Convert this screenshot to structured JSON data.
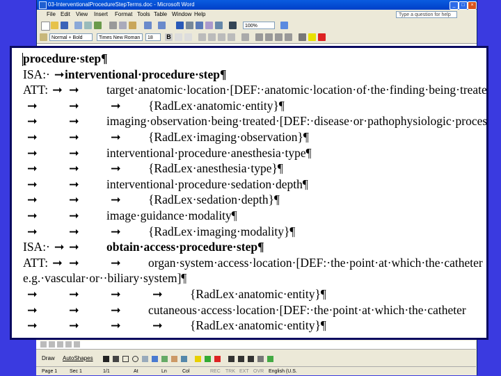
{
  "window": {
    "title": "03-InterventionalProcedureStepTerms.doc - Microsoft Word"
  },
  "menu": [
    "File",
    "Edit",
    "View",
    "Insert",
    "Format",
    "Tools",
    "Table",
    "Window",
    "Help"
  ],
  "help_box": {
    "placeholder": "Type a question for help"
  },
  "formatting": {
    "style": "Normal + Bold",
    "font": "Times New Roman",
    "size": "18",
    "zoom": "100%"
  },
  "document": {
    "lines": [
      {
        "tokens": [
          {
            "text": "procedure·step¶",
            "bold": true
          }
        ]
      },
      {
        "tokens": [
          {
            "text": "ISA:·"
          },
          {
            "tab": true
          },
          {
            "text": "interventional·procedure·step¶",
            "bold": true
          }
        ]
      },
      {
        "tokens": [
          {
            "text": "ATT:"
          },
          {
            "tab": true
          },
          {
            "tab": true
          },
          {
            "text": "target·anatomic·location·[DEF:·anatomic·location·of·the·finding·being·treated]"
          }
        ]
      },
      {
        "tokens": [
          {
            "tab": true
          },
          {
            "tab": true
          },
          {
            "tab": true
          },
          {
            "text": "{RadLex·anatomic·entity}¶"
          }
        ]
      },
      {
        "tokens": [
          {
            "tab": true
          },
          {
            "tab": true
          },
          {
            "text": "imaging·observation·being·treated·[DEF:·disease·or·pathophysiologic·process]"
          }
        ]
      },
      {
        "tokens": [
          {
            "tab": true
          },
          {
            "tab": true
          },
          {
            "tab": true
          },
          {
            "text": "{RadLex·imaging·observation}¶"
          }
        ]
      },
      {
        "tokens": [
          {
            "tab": true
          },
          {
            "tab": true
          },
          {
            "text": "interventional·procedure·anesthesia·type¶"
          }
        ]
      },
      {
        "tokens": [
          {
            "tab": true
          },
          {
            "tab": true
          },
          {
            "tab": true
          },
          {
            "text": "{RadLex·anesthesia·type}¶"
          }
        ]
      },
      {
        "tokens": [
          {
            "tab": true
          },
          {
            "tab": true
          },
          {
            "text": "interventional·procedure·sedation·depth¶"
          }
        ]
      },
      {
        "tokens": [
          {
            "tab": true
          },
          {
            "tab": true
          },
          {
            "tab": true
          },
          {
            "text": "{RadLex·sedation·depth}¶"
          }
        ]
      },
      {
        "tokens": [
          {
            "tab": true
          },
          {
            "tab": true
          },
          {
            "text": "image·guidance·modality¶"
          }
        ]
      },
      {
        "tokens": [
          {
            "tab": true
          },
          {
            "tab": true
          },
          {
            "tab": true
          },
          {
            "text": "{RadLex·imaging·modality}¶"
          }
        ]
      },
      {
        "tokens": [
          {
            "text": "ISA:·"
          },
          {
            "tab": true
          },
          {
            "tab": true
          },
          {
            "text": "obtain·access·procedure·step¶",
            "bold": true
          }
        ]
      },
      {
        "tokens": [
          {
            "text": "ATT:"
          },
          {
            "tab": true
          },
          {
            "tab": true
          },
          {
            "tab": true
          },
          {
            "text": "organ·system·access·location·[DEF:·the·point·at·which·the·catheter"
          }
        ]
      },
      {
        "tokens": [
          {
            "text": "e.g.·vascular·or··biliary·system]¶"
          }
        ]
      },
      {
        "tokens": [
          {
            "tab": true
          },
          {
            "tab": true
          },
          {
            "tab": true
          },
          {
            "tab": true
          },
          {
            "text": "{RadLex·anatomic·entity}¶"
          }
        ]
      },
      {
        "tokens": [
          {
            "tab": true
          },
          {
            "tab": true
          },
          {
            "tab": true
          },
          {
            "text": "cutaneous·access·location·[DEF:·the·point·at·which·the·catheter"
          }
        ]
      },
      {
        "tokens": [
          {
            "tab": true
          },
          {
            "tab": true
          },
          {
            "tab": true
          },
          {
            "tab": true
          },
          {
            "text": "{RadLex·anatomic·entity}¶"
          }
        ]
      }
    ],
    "tab_glyph": "➞"
  },
  "drawing_toolbar": {
    "draw_label": "Draw",
    "autoshapes_label": "AutoShapes"
  },
  "status_bar": {
    "page": "Page 1",
    "sec": "Sec 1",
    "pages": "1/1",
    "at": "At",
    "ln": "Ln",
    "col": "Col",
    "rec": "REC",
    "trk": "TRK",
    "ext": "EXT",
    "ovr": "OVR",
    "lang": "English (U.S."
  },
  "colors": {
    "slide_bg": "#3a3ae0",
    "title_bar": "#0a5ce0",
    "doc_border": "#0a0a60"
  }
}
